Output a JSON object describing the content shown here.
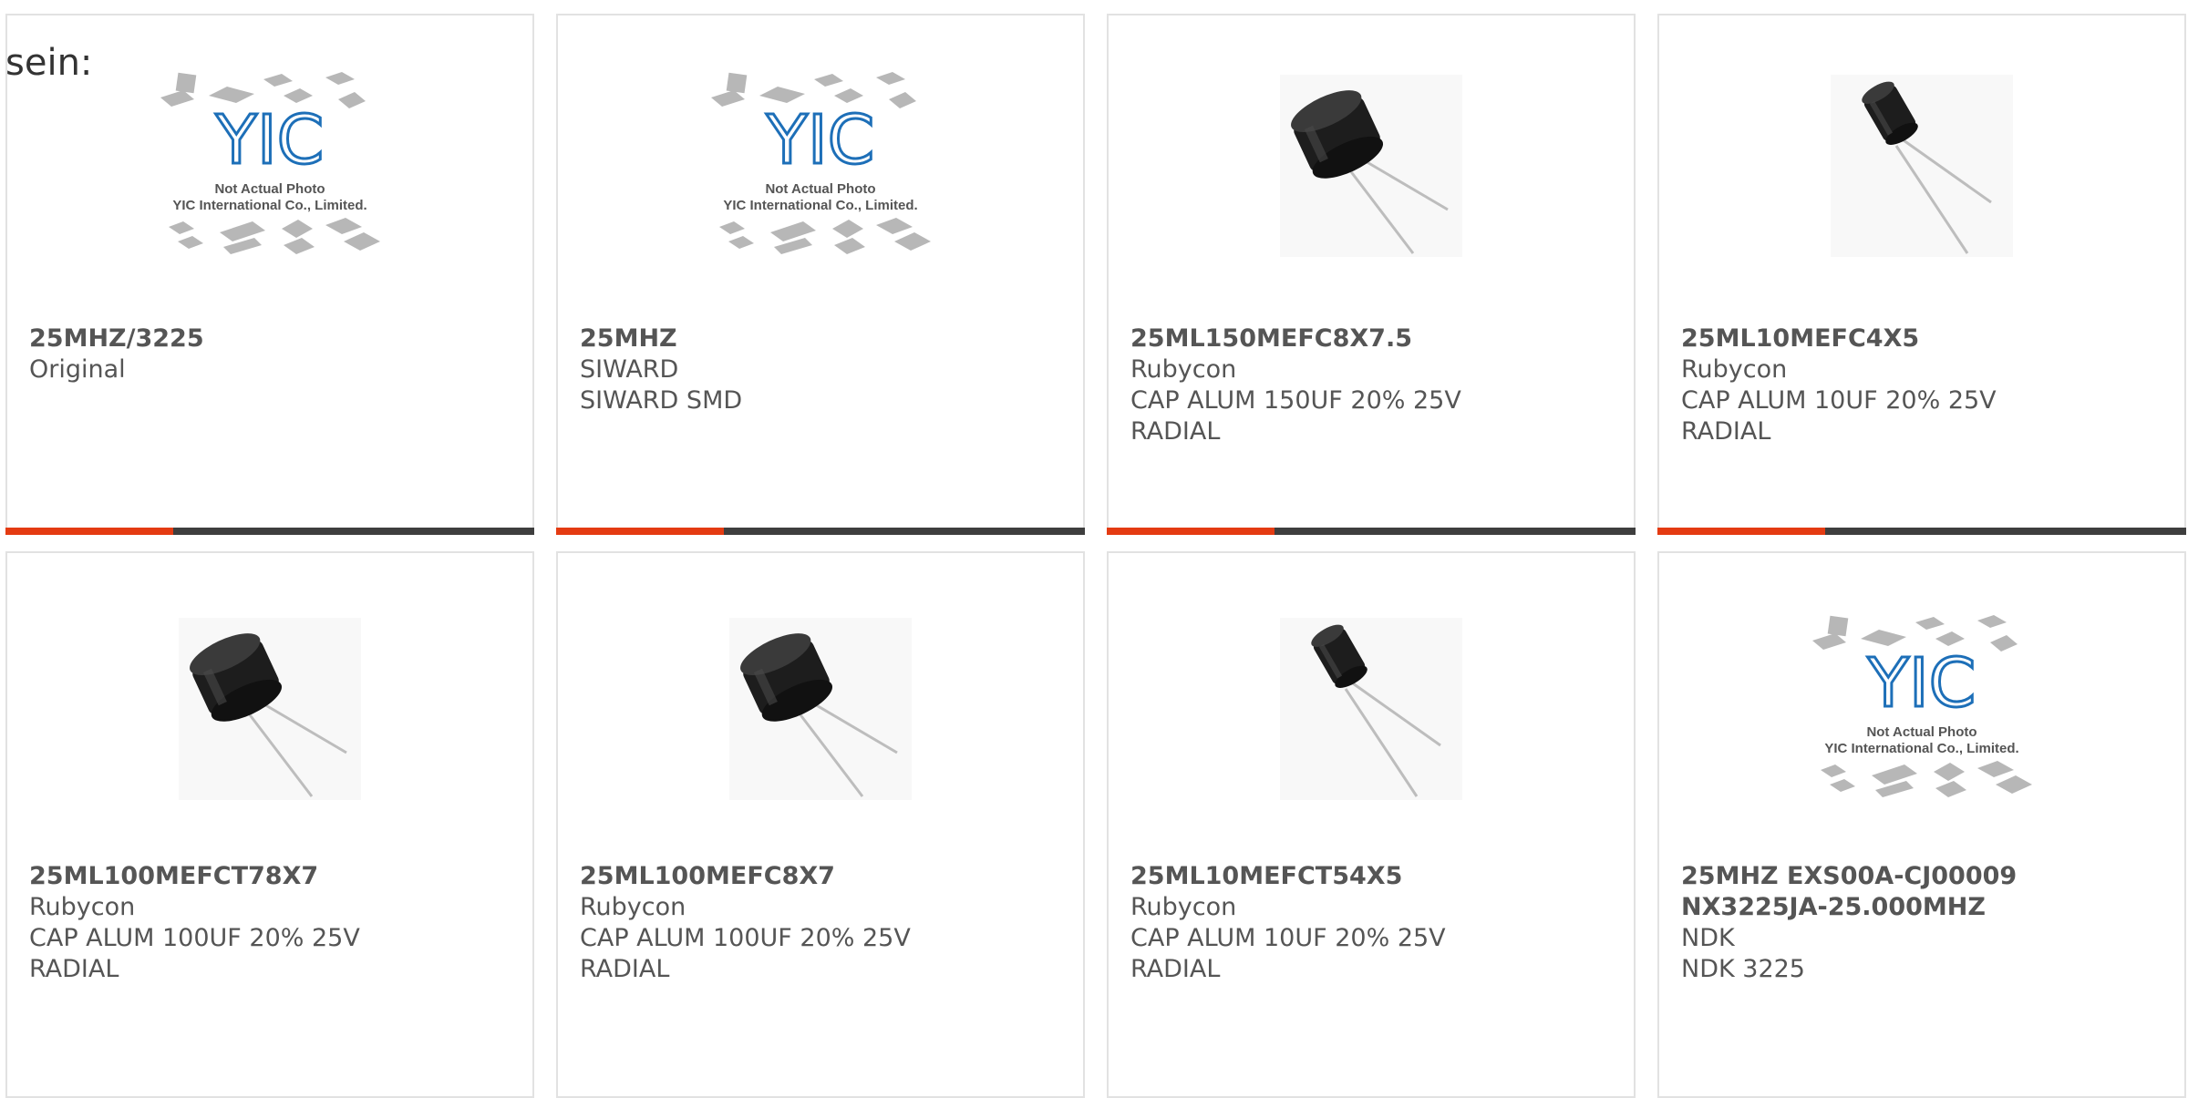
{
  "lead_text": "sein:",
  "placeholder_image": {
    "caption_line1": "Not Actual Photo",
    "caption_line2": "YIC International Co., Limited.",
    "logo_text": "YIC"
  },
  "colors": {
    "accent": "#e43b12",
    "bar": "#3e3e3e",
    "border": "#e2e2e2",
    "logo_blue": "#1d6fb8"
  },
  "products": [
    {
      "part": "25MHZ/3225",
      "lines": [
        "Original"
      ],
      "image": "placeholder"
    },
    {
      "part": "25MHZ",
      "lines": [
        "SIWARD",
        "SIWARD SMD"
      ],
      "image": "placeholder"
    },
    {
      "part": "25ML150MEFC8X7.5",
      "lines": [
        "Rubycon",
        "CAP ALUM 150UF 20% 25V",
        "RADIAL"
      ],
      "image": "capacitor-large"
    },
    {
      "part": "25ML10MEFC4X5",
      "lines": [
        "Rubycon",
        "CAP ALUM 10UF 20% 25V",
        "RADIAL"
      ],
      "image": "capacitor-small"
    },
    {
      "part": "25ML100MEFCT78X7",
      "lines": [
        "Rubycon",
        "CAP ALUM 100UF 20% 25V",
        "RADIAL"
      ],
      "image": "capacitor-large"
    },
    {
      "part": "25ML100MEFC8X7",
      "lines": [
        "Rubycon",
        "CAP ALUM 100UF 20% 25V",
        "RADIAL"
      ],
      "image": "capacitor-large"
    },
    {
      "part": "25ML10MEFCT54X5",
      "lines": [
        "Rubycon",
        "CAP ALUM 10UF 20% 25V",
        "RADIAL"
      ],
      "image": "capacitor-small"
    },
    {
      "part": "25MHZ EXS00A-CJ00009 NX3225JA-25.000MHZ",
      "lines": [
        "NDK",
        "NDK 3225"
      ],
      "image": "placeholder"
    }
  ]
}
